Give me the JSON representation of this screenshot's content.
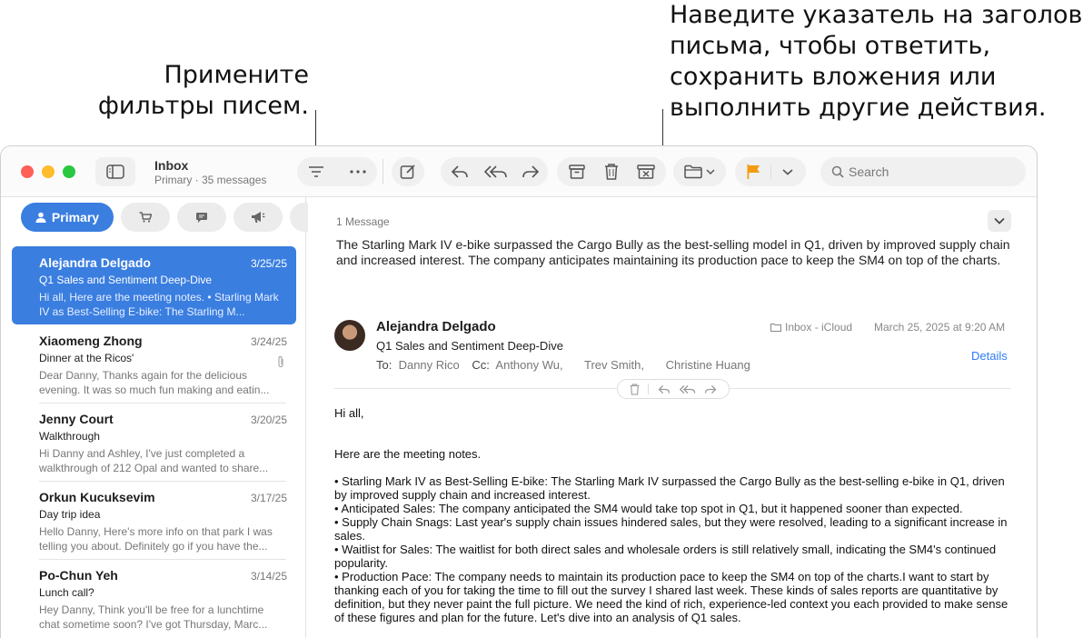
{
  "callouts": {
    "filters": [
      "Примените",
      "фильтры писем."
    ],
    "hover": [
      "Наведите указатель на заголовок",
      "письма, чтобы ответить,",
      "сохранить вложения или",
      "выполнить другие действия."
    ]
  },
  "toolbar": {
    "mailbox_title": "Inbox",
    "mailbox_subtitle": "Primary · 35 messages",
    "search_placeholder": "Search",
    "flag_color": "#f39c12"
  },
  "categories": {
    "primary_label": "Primary",
    "accent": "#3a7ee0"
  },
  "messages": [
    {
      "from": "Alejandra Delgado",
      "date": "3/25/25",
      "subject": "Q1 Sales and Sentiment Deep-Dive",
      "preview": "Hi all, Here are the meeting notes. • Starling Mark IV as Best-Selling E-bike: The Starling M..."
    },
    {
      "from": "Xiaomeng Zhong",
      "date": "3/24/25",
      "subject": "Dinner at the Ricos'",
      "preview": "Dear Danny, Thanks again for the delicious evening. It was so much fun making and eatin..."
    },
    {
      "from": "Jenny Court",
      "date": "3/20/25",
      "subject": "Walkthrough",
      "preview": "Hi Danny and Ashley, I've just completed a walkthrough of 212 Opal and wanted to share..."
    },
    {
      "from": "Orkun Kucuksevim",
      "date": "3/17/25",
      "subject": "Day trip idea",
      "preview": "Hello Danny, Here's more info on that park I was telling you about. Definitely go if you have the..."
    },
    {
      "from": "Po-Chun Yeh",
      "date": "3/14/25",
      "subject": "Lunch call?",
      "preview": "Hey Danny, Think you'll be free for a lunchtime chat sometime soon? I've got Thursday, Marc..."
    }
  ],
  "reader": {
    "message_count": "1 Message",
    "summary": "The Starling Mark IV e-bike surpassed the Cargo Bully as the best-selling model in Q1, driven by improved supply chain and increased interest. The company anticipates maintaining its production pace to keep the SM4 on top of the charts.",
    "sender": "Alejandra Delgado",
    "subject": "Q1 Sales and Sentiment Deep-Dive",
    "to_label": "To:",
    "to": "Danny Rico",
    "cc_label": "Cc:",
    "cc1": "Anthony Wu,",
    "cc2": "Trev Smith,",
    "cc3": "Christine Huang",
    "mailbox": "Inbox - iCloud",
    "date": "March 25, 2025 at 9:20 AM",
    "details": "Details",
    "greeting": "Hi all,",
    "intro": "Here are the meeting notes.",
    "bullets": [
      "• Starling Mark IV as Best-Selling E-bike: The Starling Mark IV surpassed the Cargo Bully as the best-selling e-bike in Q1, driven by improved supply chain and increased interest.",
      "• Anticipated Sales: The company anticipated the SM4 would take top spot in Q1, but it happened sooner than expected.",
      "• Supply Chain Snags: Last year's supply chain issues hindered sales, but they were resolved, leading to a significant increase in sales.",
      "• Waitlist for Sales: The waitlist for both direct sales and wholesale orders is still relatively small, indicating the SM4's continued popularity.",
      "• Production Pace: The company needs to maintain its production pace to keep the SM4 on top of the charts.I want to start by thanking each of you for taking the time to fill out the survey I shared last week. These kinds of sales reports are quantitative by definition, but they never paint the full picture. We need the kind of rich, experience-led context you each provided to make sense of these figures and plan for the future. Let's dive into an analysis of Q1 sales."
    ]
  }
}
